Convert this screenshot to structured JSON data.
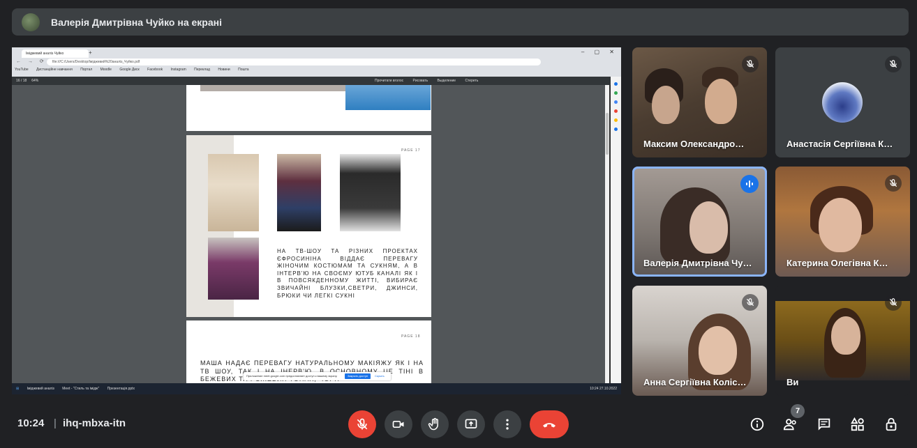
{
  "presenter_bar": {
    "text": "Валерія Дмитрівна Чуйко на екрані"
  },
  "shared_screen": {
    "browser_tab_title": "Іміджевий аналіз Чуйко",
    "address": "file:///C:/Users/Desktop/Іміджевий%20аналіз_Чуйко.pdf",
    "bookmarks": [
      "YouTube",
      "Дистанційне навчання",
      "Портал",
      "Moodle",
      "Google Диск",
      "Facebook",
      "Instagram",
      "Переклад",
      "Новини",
      "Пошта"
    ],
    "pdf_toolbar": {
      "page_info": "16 / 18",
      "zoom": "64%",
      "tools": [
        "Прочитати вголос",
        "Рисовать",
        "Выделение",
        "Стереть"
      ]
    },
    "page2": {
      "page_tag": "PAGE 17",
      "text": "НА ТВ-ШОУ ТА РІЗНИХ ПРОЕКТАХ ЄФРОСИНІНА ВІДДАЄ ПЕРЕВАГУ ЖІНОЧИМ КОСТЮМАМ ТА СУКНЯМ, А В ІНТЕРВ'Ю НА СВОЄМУ ЮТУБ КАНАЛІ ЯК І В ПОВСЯКДЕННОМУ ЖИТТІ, ВИБИРАЄ ЗВИЧАЙНІ БЛУЗКИ,СВЕТРИ, ДЖИНСИ, БРЮКИ ЧИ ЛЕГКІ СУКНІ"
    },
    "page3": {
      "page_tag": "PAGE 18",
      "text": "МАША НАДАЄ ПЕРЕВАГУ НАТУРАЛЬНОМУ МАКІЯЖУ ЯК І НА ТВ ШОУ, ТАК І НА ІНЕРВ'Ю. В ОСНОВНОМУ ЦЕ ТІНІ В БЕЖЕВИХ ТА РОЖЕВИХ ТОНАХ, ЧОРН"
    },
    "notification": {
      "text": "Приложение meet.google.com предоставляет доступ к вашему экрану.",
      "primary_button": "Закрыть доступ",
      "secondary_button": "Скрыть"
    },
    "taskbar": {
      "items": [
        "Іміджевий аналіз",
        "Meet - \"Стиль та імідж\"",
        "Презентація.pptx"
      ],
      "tray": "10:24  27.10.2022"
    }
  },
  "participants": [
    {
      "name": "Максим Олександро…",
      "muted": true,
      "speaking": false
    },
    {
      "name": "Анастасія Сергіївна К…",
      "muted": true,
      "speaking": false
    },
    {
      "name": "Валерія Дмитрівна Чу…",
      "muted": false,
      "speaking": true
    },
    {
      "name": "Катерина Олегівна К…",
      "muted": true,
      "speaking": false
    },
    {
      "name": "Анна Сергіївна Коліс…",
      "muted": true,
      "speaking": false
    },
    {
      "name": "Ви",
      "muted": true,
      "speaking": false
    }
  ],
  "bottom_bar": {
    "time": "10:24",
    "separator": "|",
    "meeting_code": "ihq-mbxa-itn",
    "people_count": "7"
  },
  "colors": {
    "background": "#202124",
    "tile": "#3c4043",
    "danger": "#ea4335",
    "accent": "#1a73e8",
    "speaking_outline": "#8ab4f8"
  }
}
